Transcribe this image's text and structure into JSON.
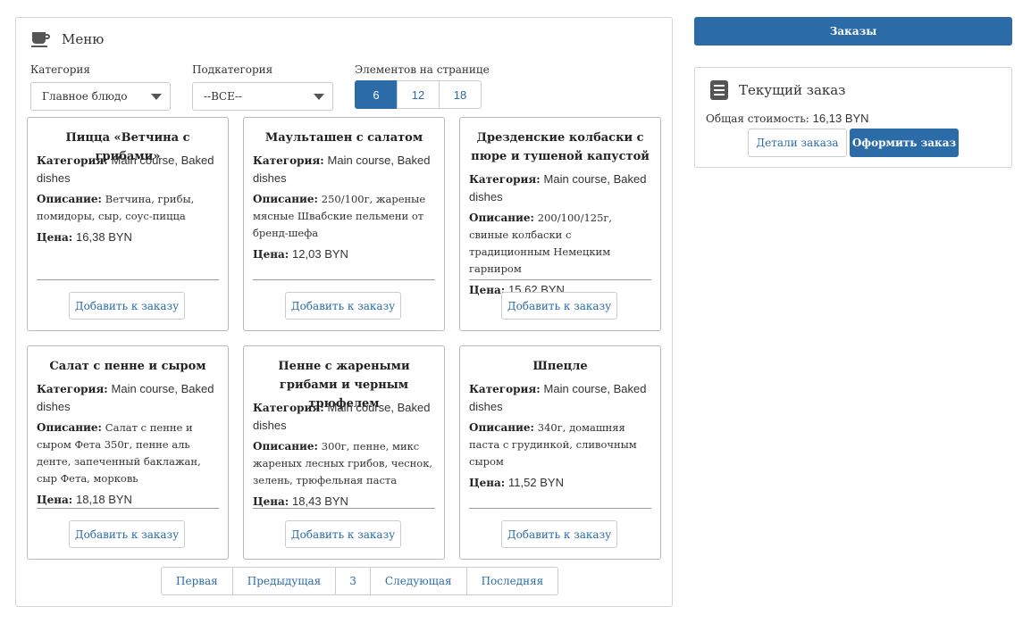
{
  "menu": {
    "title": "Меню",
    "icon": "coffee-cup-icon",
    "filters": {
      "category_label": "Категория",
      "category_value": "Главное блюдо",
      "subcategory_label": "Подкатегория",
      "subcategory_value": "--ВСЕ--",
      "page_size_label": "Элементов на странице",
      "page_sizes": [
        "6",
        "12",
        "18"
      ],
      "page_size_selected": "6"
    },
    "labels": {
      "category": "Категория:",
      "description": "Описание:",
      "price": "Цена:",
      "add_button": "Добавить к заказу"
    },
    "items": [
      {
        "name": "Пицца «Ветчина с грибами»",
        "category": "Main course, Baked dishes",
        "description": "Ветчина, грибы, помидоры, сыр, соус-пицца",
        "price": "16,38 BYN"
      },
      {
        "name": "Маульташен с салатом",
        "category": "Main course, Baked dishes",
        "description": "250/100г, жареные мясные Швабские пельмени от бренд-шефа",
        "price": "12,03 BYN"
      },
      {
        "name": "Дрезденские колбаски с пюре и тушеной капустой",
        "category": "Main course, Baked dishes",
        "description": "200/100/125г, свиные колбаски с традиционным Немецким гарниром",
        "price": "15,62 BYN"
      },
      {
        "name": "Салат с пенне и сыром",
        "category": "Main course, Baked dishes",
        "description": "Салат с пенне и сыром Фета 350г, пенне аль денте, запеченный баклажан, сыр Фета, морковь",
        "price": "18,18 BYN"
      },
      {
        "name": "Пенне с жареными грибами и черным трюфелем",
        "category": "Main course, Baked dishes",
        "description": "300г, пенне, микс жареных лесных грибов, чеснок, зелень, трюфельная паста",
        "price": "18,43 BYN"
      },
      {
        "name": "Шпецле",
        "category": "Main course, Baked dishes",
        "description": "340г, домашняя паста с грудинкой, сливочным сыром",
        "price": "11,52 BYN"
      }
    ],
    "pagination": [
      "Первая",
      "Предыдущая",
      "3",
      "Следующая",
      "Последняя"
    ]
  },
  "sidebar": {
    "orders_button": "Заказы",
    "current_order": {
      "title": "Текущий заказ",
      "icon": "document-list-icon",
      "total_label": "Общая стоимость:",
      "total_value": "16,13 BYN",
      "details_button": "Детали заказа",
      "checkout_button": "Оформить заказ"
    }
  },
  "colors": {
    "primary": "#2a6ba8",
    "border": "#d4d4d4"
  }
}
